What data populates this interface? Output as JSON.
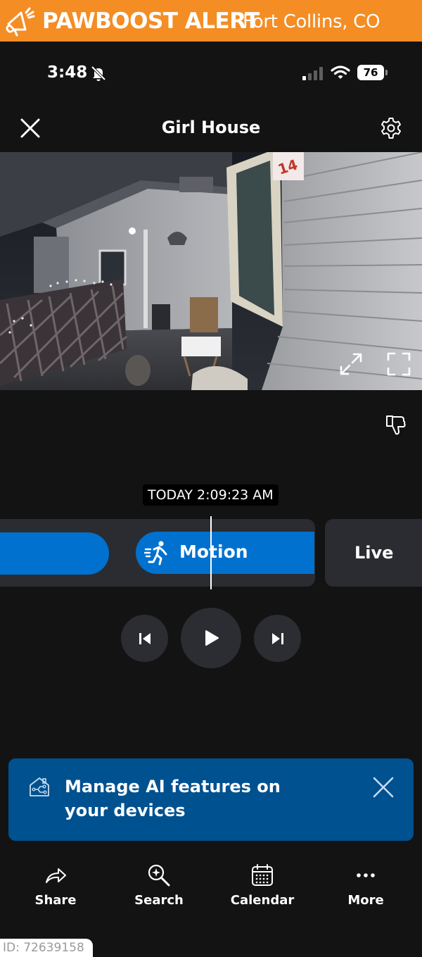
{
  "alert": {
    "title": "PAWBOOST ALERT",
    "location": "Fort Collins, CO"
  },
  "status_bar": {
    "time": "3:48",
    "battery": "76"
  },
  "header": {
    "title": "Girl House"
  },
  "player": {
    "timestamp": "TODAY 2:09:23 AM",
    "event_label": "Motion",
    "live_label": "Live"
  },
  "ai_banner": {
    "text": "Manage AI features on your devices"
  },
  "bottom_nav": {
    "items": [
      {
        "label": "Share",
        "icon": "share-icon"
      },
      {
        "label": "Search",
        "icon": "search-icon"
      },
      {
        "label": "Calendar",
        "icon": "calendar-icon"
      },
      {
        "label": "More",
        "icon": "more-icon"
      }
    ]
  },
  "listing_id": "ID: 72639158",
  "colors": {
    "alert_orange": "#f48d24",
    "event_blue": "#0071ce",
    "banner_blue": "#00518f",
    "background": "#131313"
  }
}
